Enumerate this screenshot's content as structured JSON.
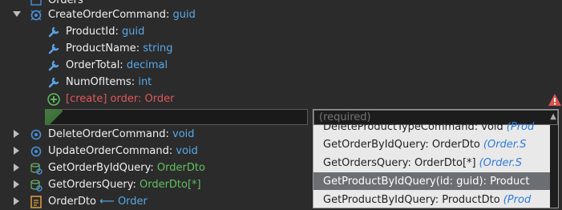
{
  "tree": {
    "top_partial": "Orders",
    "create_command": {
      "name": "CreateOrderCommand:",
      "type": "guid"
    },
    "props": [
      {
        "name": "ProductId:",
        "type": "guid"
      },
      {
        "name": "ProductName:",
        "type": "string"
      },
      {
        "name": "OrderTotal:",
        "type": "decimal"
      },
      {
        "name": "NumOfItems:",
        "type": "int"
      }
    ],
    "association": {
      "text": "[create] order: Order"
    },
    "siblings": [
      {
        "name": "DeleteOrderCommand:",
        "type": "void"
      },
      {
        "name": "UpdateOrderCommand:",
        "type": "void"
      },
      {
        "name": "GetOrderByIdQuery:",
        "type": "OrderDto"
      },
      {
        "name": "GetOrdersQuery:",
        "type": "OrderDto[*]"
      },
      {
        "name": "OrderDto",
        "rel_type": "Order"
      }
    ]
  },
  "dropdown": {
    "placeholder": "(required)",
    "items": [
      {
        "label": "DeleteProductTypeCommand: void",
        "hint": "(Prod"
      },
      {
        "label": "GetOrderByIdQuery: OrderDto",
        "hint": "(Order.S"
      },
      {
        "label": "GetOrdersQuery: OrderDto[*]",
        "hint": "(Order.S"
      },
      {
        "label": "GetProductByIdQuery(id: guid): Product",
        "hint": ""
      },
      {
        "label": "GetProductByIdQuery: ProductDto",
        "hint": "(Prod"
      }
    ],
    "selected_index": 3
  },
  "colors": {
    "type": "#59a9e8",
    "error": "#e0585c",
    "icon": "#4a90d9",
    "warning": "#d9534f"
  }
}
